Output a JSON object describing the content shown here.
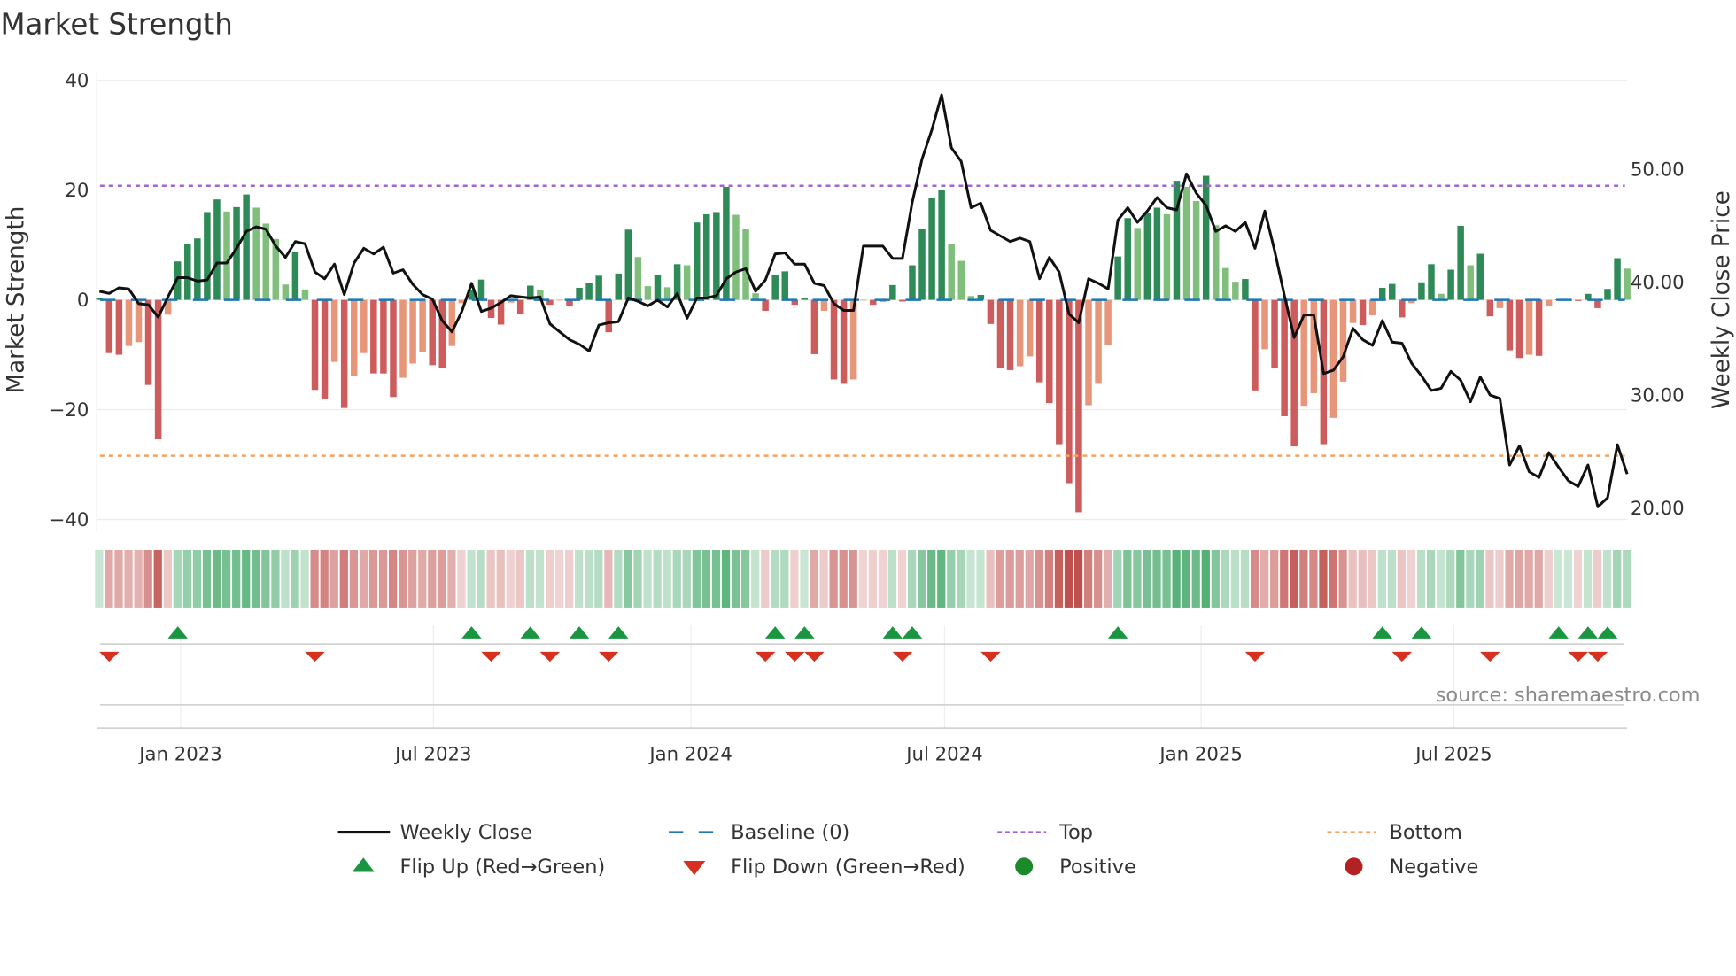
{
  "title": "Market Strength",
  "source": "source: sharemaestro.com",
  "chart_data": {
    "type": "bar",
    "title": "Market Strength",
    "ylabel": "Market Strength",
    "y2label": "Weekly Close Price",
    "ylim": [
      -40,
      40
    ],
    "y2lim": [
      20,
      50
    ],
    "yticks": [
      "40",
      "20",
      "0",
      "−20",
      "−40"
    ],
    "ytick_values": [
      40,
      20,
      0,
      -20,
      -40
    ],
    "y2ticks": [
      "50.00",
      "40.00",
      "30.00",
      "20.00"
    ],
    "y2tick_values": [
      50,
      40,
      30,
      20
    ],
    "x_unit": "week index (weekly, Nov 2022 - Oct 2025)",
    "x_ticks": [
      {
        "label": "Jan 2023",
        "week": 8.3
      },
      {
        "label": "Jul 2023",
        "week": 34.1
      },
      {
        "label": "Jan 2024",
        "week": 60.4
      },
      {
        "label": "Jul 2024",
        "week": 86.3
      },
      {
        "label": "Jan 2025",
        "week": 112.5
      },
      {
        "label": "Jul 2025",
        "week": 138.3
      }
    ],
    "top_level": 20.8,
    "bottom_level": -28.4,
    "baseline": 0,
    "colors": {
      "pos_up": "#2e8b57",
      "pos_down": "#7fbf7b",
      "neg_down": "#cd5c5c",
      "neg_up": "#e8967a",
      "close": "#111111",
      "baseline": "#1f77b4",
      "top": "#a066d3",
      "bottom": "#f4a261",
      "flip_up": "#1a9641",
      "flip_down": "#d7301f",
      "positive": "#1a8a2a",
      "negative": "#b22222"
    },
    "strength": [
      0.3,
      -9.7,
      -10,
      -8.4,
      -7.7,
      -15.5,
      -25.4,
      -2.7,
      7,
      10.2,
      11.2,
      16,
      18.3,
      16.1,
      16.9,
      19.2,
      16.8,
      13.9,
      11.1,
      2.8,
      8.7,
      1.9,
      -16.4,
      -18.1,
      -11.3,
      -19.7,
      -13.9,
      -9.7,
      -13.4,
      -13.4,
      -17.7,
      -14.2,
      -11.6,
      -9.5,
      -11.9,
      -12.4,
      -8.4,
      -0.6,
      1.8,
      3.7,
      -3.3,
      -4.5,
      -0.5,
      -2.5,
      2.6,
      1.8,
      -0.9,
      -0.1,
      -1.1,
      2.2,
      3.0,
      4.4,
      -5.9,
      4.8,
      12.8,
      7.8,
      2.5,
      4.5,
      2.3,
      6.5,
      6.3,
      14.1,
      15.6,
      16,
      20.6,
      15.5,
      13,
      1.2,
      -2,
      4.6,
      5.2,
      -0.9,
      0.3,
      -9.9,
      -2,
      -14.5,
      -15.3,
      -14.5,
      -0.1,
      -0.9,
      -0.4,
      2.7,
      -0.3,
      6.3,
      12.9,
      18.6,
      20.1,
      10.2,
      7.1,
      0.7,
      0.9,
      -4.4,
      -12.5,
      -12.8,
      -12.1,
      -10.3,
      -15,
      -18.8,
      -26.3,
      -33.4,
      -38.7,
      -19.2,
      -15.3,
      -8.3,
      7.9,
      14.9,
      13.1,
      15.8,
      16.8,
      15.6,
      21.7,
      20.6,
      18,
      22.6,
      13.6,
      5.8,
      3.3,
      3.8,
      -16.5,
      -9,
      -12.5,
      -21.2,
      -26.7,
      -19.3,
      -17,
      -26.3,
      -21.5,
      -14.9,
      -4.2,
      -4.6,
      -2.8,
      2.2,
      2.9,
      -3.2,
      -0.6,
      3.2,
      6.5,
      1.1,
      5.5,
      13.5,
      6.3,
      8.4,
      -3,
      -1.5,
      -9.2,
      -10.6,
      -10,
      -10.2,
      -1.1,
      0.1,
      0.1,
      -0.2,
      1.1,
      -1.5,
      2.0,
      7.6,
      5.7
    ],
    "close": [
      39.2,
      39.0,
      39.5,
      39.4,
      38.1,
      38.0,
      36.9,
      38.7,
      40.4,
      40.4,
      40.1,
      40.2,
      41.7,
      41.7,
      43.0,
      44.5,
      44.9,
      44.7,
      43.2,
      42.2,
      43.6,
      43.4,
      40.9,
      40.3,
      41.6,
      38.9,
      41.7,
      43.0,
      42.5,
      43.1,
      40.8,
      41.1,
      39.8,
      38.9,
      38.5,
      36.6,
      35.6,
      37.4,
      39.9,
      37.4,
      37.7,
      38.2,
      38.8,
      38.7,
      38.6,
      38.7,
      36.3,
      35.6,
      34.9,
      34.5,
      33.9,
      36.2,
      36.4,
      36.5,
      38.6,
      38.3,
      37.9,
      38.4,
      37.8,
      39.0,
      36.8,
      38.6,
      38.6,
      38.8,
      40.3,
      40.9,
      41.2,
      39.2,
      40.2,
      42.5,
      42.6,
      41.6,
      41.6,
      39.9,
      39.7,
      38.1,
      37.5,
      37.5,
      43.2,
      43.2,
      43.2,
      42.1,
      42.1,
      47.1,
      50.9,
      53.5,
      56.6,
      51.9,
      50.7,
      46.6,
      47.0,
      44.6,
      44.1,
      43.6,
      43.9,
      43.6,
      40.3,
      42.2,
      40.9,
      37.2,
      36.4,
      40.3,
      39.9,
      39.4,
      45.5,
      46.6,
      45.3,
      46.3,
      47.5,
      46.6,
      46.4,
      49.6,
      47.9,
      46.8,
      44.5,
      45.0,
      44.5,
      45.3,
      43.0,
      46.3,
      42.8,
      38.8,
      35.1,
      37.1,
      37.1,
      31.9,
      32.2,
      33.4,
      35.9,
      34.9,
      34.4,
      36.6,
      34.7,
      34.6,
      32.8,
      31.7,
      30.4,
      30.6,
      32.1,
      31.3,
      29.4,
      31.6,
      30.0,
      29.7,
      23.8,
      25.5,
      23.2,
      22.7,
      24.9,
      23.6,
      22.4,
      21.9,
      23.8,
      20.1,
      20.9,
      25.6,
      23.0
    ],
    "flip_up_weeks": [
      8,
      38,
      44,
      49,
      53,
      69,
      72,
      81,
      83,
      104,
      131,
      135,
      149,
      152,
      154
    ],
    "flip_down_weeks": [
      1,
      22,
      40,
      46,
      52,
      68,
      71,
      73,
      82,
      91,
      118,
      133,
      142,
      151,
      153
    ]
  },
  "legend": [
    {
      "label": "Weekly Close",
      "kind": "line"
    },
    {
      "label": "Baseline (0)",
      "kind": "baseline"
    },
    {
      "label": "Top",
      "kind": "top"
    },
    {
      "label": "Bottom",
      "kind": "bottom"
    },
    {
      "label": "Flip Up (Red→Green)",
      "kind": "flip-up"
    },
    {
      "label": "Flip Down (Green→Red)",
      "kind": "flip-down"
    },
    {
      "label": "Positive",
      "kind": "positive"
    },
    {
      "label": "Negative",
      "kind": "negative"
    }
  ]
}
